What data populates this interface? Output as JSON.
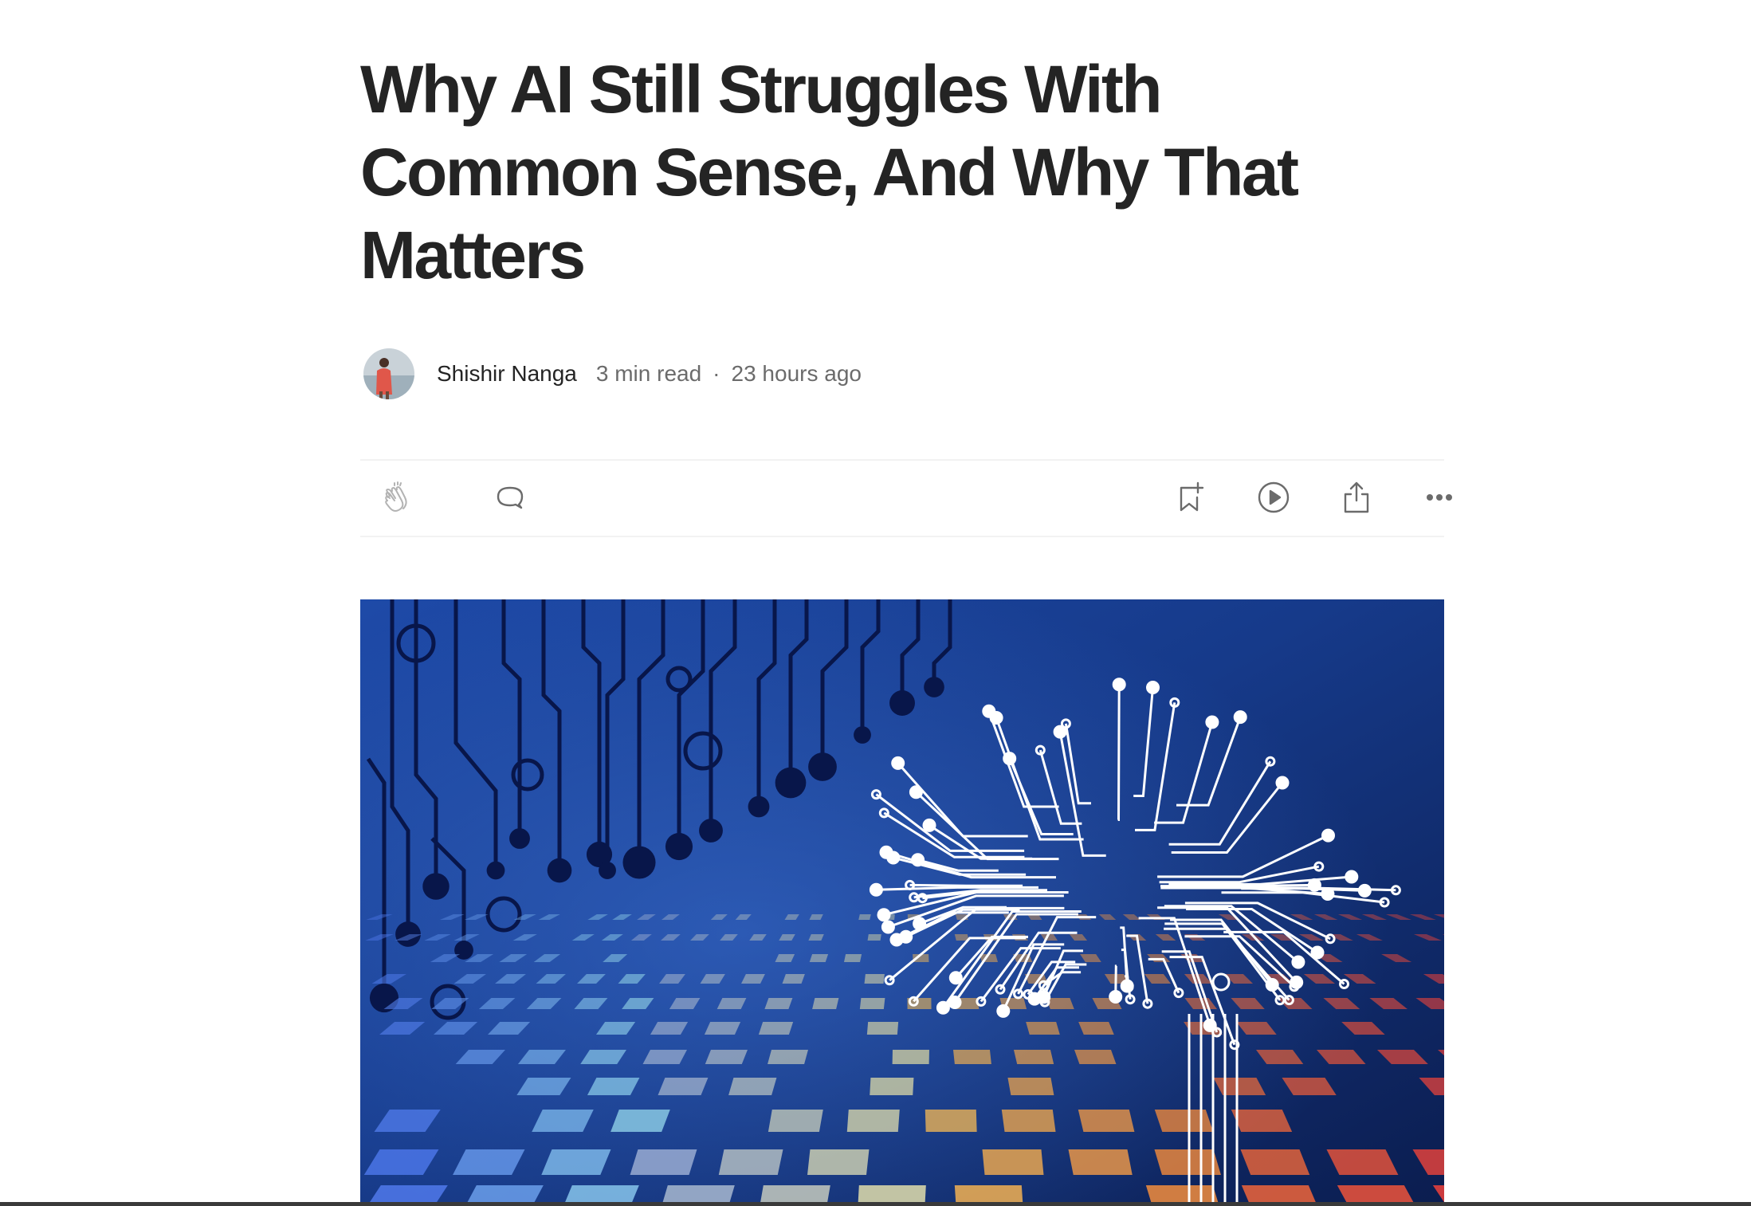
{
  "article": {
    "title": "Why AI Still Struggles With Common Sense, And Why That Matters",
    "author": "Shishir Nanga",
    "read_time": "3 min read",
    "separator": "·",
    "published": "23 hours ago"
  },
  "actions": {
    "left": [
      {
        "name": "clap-button",
        "icon": "clap-icon"
      },
      {
        "name": "response-button",
        "icon": "speech-bubble-icon"
      }
    ],
    "right": [
      {
        "name": "bookmark-button",
        "icon": "bookmark-add-icon"
      },
      {
        "name": "listen-button",
        "icon": "play-circle-icon"
      },
      {
        "name": "share-button",
        "icon": "share-icon"
      },
      {
        "name": "more-button",
        "icon": "more-dots-icon"
      }
    ]
  },
  "hero": {
    "icon": "ai-brain-circuit-illustration",
    "colors": {
      "bg_dark": "#0d1f4d",
      "bg_mid": "#1a3a86",
      "circuit": "#08164a",
      "brain": "#ffffff"
    }
  },
  "theme": {
    "text": "#242424",
    "muted": "#6b6b6b",
    "divider": "#f2f2f2",
    "icon": "#6b6b6b"
  }
}
